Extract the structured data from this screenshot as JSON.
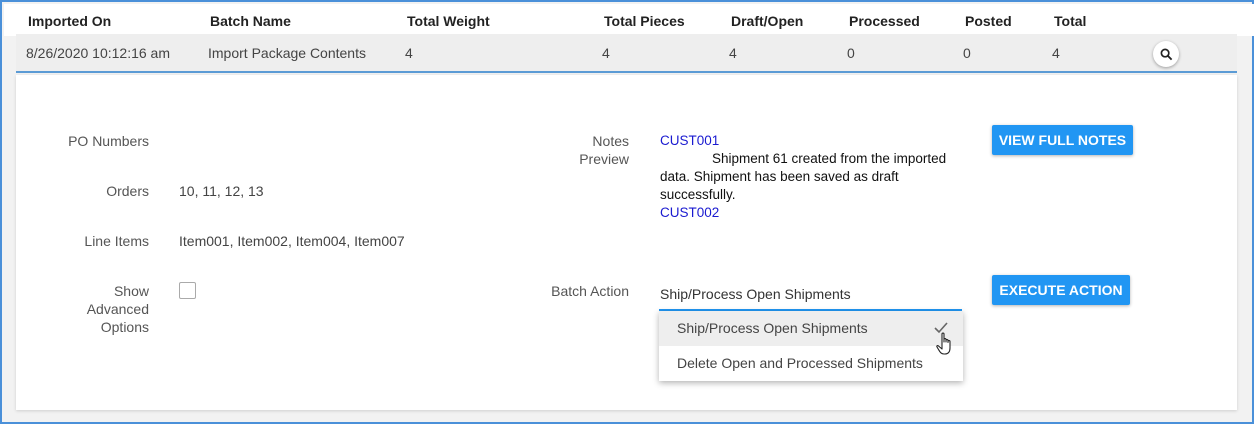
{
  "table": {
    "headers": [
      "Imported On",
      "Batch Name",
      "Total Weight",
      "Total Pieces",
      "Draft/Open",
      "Processed",
      "Posted",
      "Total"
    ],
    "row": [
      "8/26/2020 10:12:16 am",
      "Import Package Contents",
      "4",
      "4",
      "4",
      "0",
      "0",
      "4"
    ]
  },
  "details": {
    "po_label": "PO Numbers",
    "po_value": "",
    "orders_label": "Orders",
    "orders_value": "10, 11, 12, 13",
    "line_items_label": "Line Items",
    "line_items_value": "Item001, Item002, Item004, Item007",
    "advanced_label_1": "Show",
    "advanced_label_2": "Advanced",
    "advanced_label_3": "Options",
    "notes_label_1": "Notes",
    "notes_label_2": "Preview",
    "notes_cust_1": "CUST001",
    "notes_message": "Shipment 61 created from the imported data. Shipment has been saved as draft successfully.",
    "notes_cust_2": "CUST002",
    "view_notes_button": "VIEW FULL NOTES",
    "batch_action_label": "Batch Action",
    "batch_action_value": "Ship/Process Open Shipments",
    "execute_button": "EXECUTE ACTION",
    "options": [
      "Ship/Process Open Shipments",
      "Delete Open and Processed Shipments"
    ]
  },
  "colors": {
    "accent": "#2196f3",
    "link": "#1a1ad0",
    "frame": "#4a90d9"
  },
  "icons": {
    "search": "search-icon",
    "check": "check-icon",
    "cursor": "hand-cursor-icon"
  }
}
